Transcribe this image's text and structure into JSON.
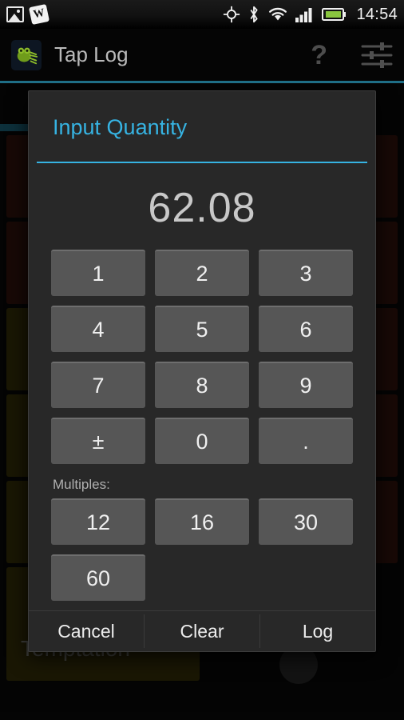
{
  "statusbar": {
    "icons_left": [
      "gallery-icon",
      "wikipedia-icon"
    ],
    "icons_right": [
      "gps-icon",
      "bluetooth-icon",
      "wifi-icon",
      "signal-icon",
      "battery-icon"
    ],
    "clock": "14:54",
    "wikipedia_glyph": "W"
  },
  "actionbar": {
    "app_icon": "tap-log-frog-icon",
    "title": "Tap Log",
    "help_glyph": "?",
    "settings_icon": "sliders-icon",
    "accent": "#1f6e86"
  },
  "background": {
    "wide_card_label": "Temptation",
    "left_rows": [
      "red",
      "red",
      "olive",
      "olive",
      "olive",
      "olive"
    ],
    "right_rows": [
      "red",
      "red",
      "red",
      "red",
      "red"
    ],
    "colors": {
      "red": "#36150f",
      "olive": "#3a3409",
      "teal_bar": "#1d6b84"
    }
  },
  "dialog": {
    "title": "Input Quantity",
    "title_color": "#36b3e2",
    "value": "62.08",
    "keypad": [
      [
        "1",
        "2",
        "3"
      ],
      [
        "4",
        "5",
        "6"
      ],
      [
        "7",
        "8",
        "9"
      ],
      [
        "±",
        "0",
        "."
      ]
    ],
    "multiples_label": "Multiples:",
    "multiples": [
      [
        "12",
        "16",
        "30"
      ],
      [
        "60",
        "",
        ""
      ]
    ],
    "buttons": {
      "cancel": "Cancel",
      "clear": "Clear",
      "log": "Log"
    }
  }
}
